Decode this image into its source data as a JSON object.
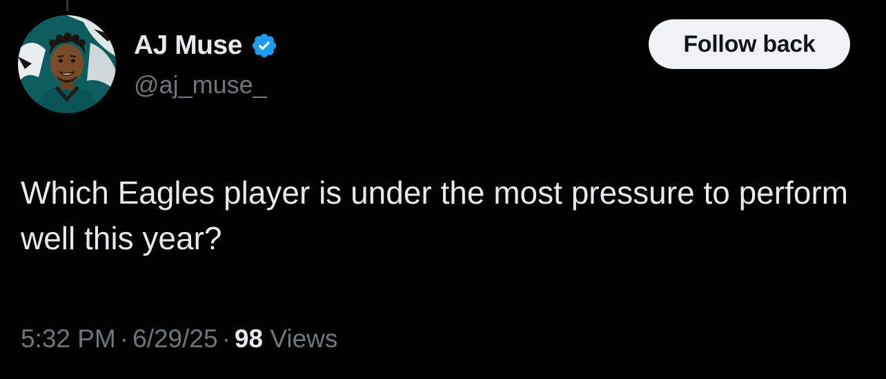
{
  "tweet": {
    "author": {
      "display_name": "AJ Muse",
      "handle": "@aj_muse_",
      "verified": true,
      "verified_icon": "verified-badge-icon",
      "avatar": "cartoon-avatar-eagles"
    },
    "follow_button_label": "Follow back",
    "text": "Which Eagles player is under the most pressure to perform well this year?",
    "time": "5:32 PM",
    "separator": "·",
    "date": "6/29/25",
    "views_count": "98",
    "views_label": "Views"
  },
  "colors": {
    "background": "#000000",
    "primary_text": "#e7e9ea",
    "secondary_text": "#71767b",
    "verified_blue": "#1d9bf0",
    "button_bg": "#eff3f4",
    "button_text": "#0f1419"
  }
}
